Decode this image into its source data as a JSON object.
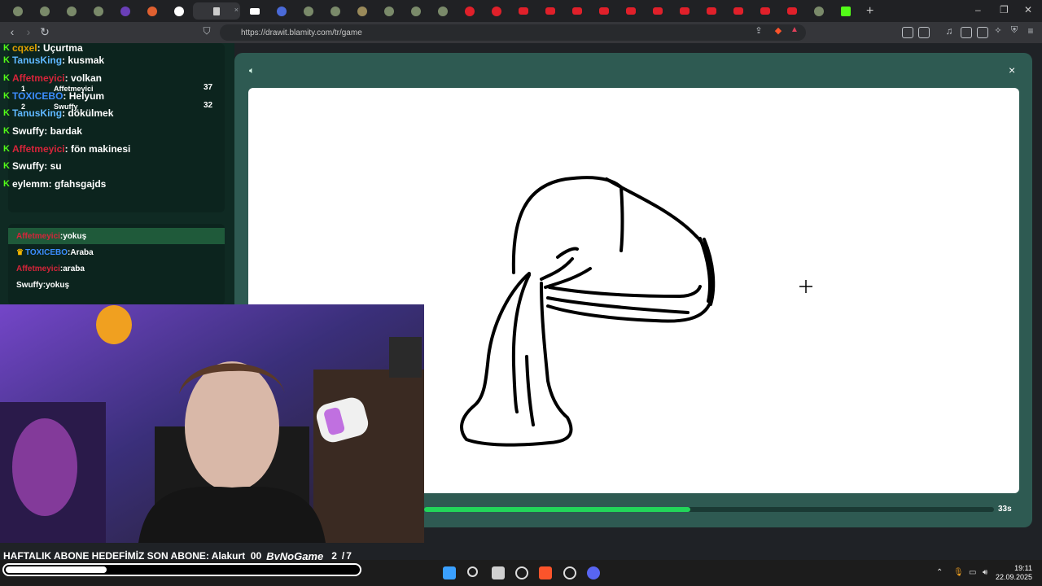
{
  "browser": {
    "url": "https://drawit.blamity.com/tr/game",
    "newtab_label": "+",
    "tab_close_glyph": "×"
  },
  "window_controls": {
    "minimize": "–",
    "maximize": "❐",
    "close": "✕"
  },
  "chat": {
    "messages": [
      {
        "user": "cqxel",
        "user_color": "#e0a000",
        "text": " : Uçurtma"
      },
      {
        "user": "TanusKing",
        "user_color": "#5fb8ff",
        "text": " : kusmak"
      },
      {
        "user": "Affetmeyici",
        "user_color": "#d6253a",
        "text": " : volkan"
      },
      {
        "user": "TOXICEBO",
        "user_color": "#3c8dff",
        "text": " : Helyum"
      },
      {
        "user": "TanusKing",
        "user_color": "#5fb8ff",
        "text": " : dökülmek"
      },
      {
        "user": "Swuffy",
        "user_color": "#ffffff",
        "text": " : bardak"
      },
      {
        "user": "Affetmeyici",
        "user_color": "#d6253a",
        "text": " : fön makinesi"
      },
      {
        "user": "Swuffy",
        "user_color": "#ffffff",
        "text": " : su"
      },
      {
        "user": "eylemm",
        "user_color": "#ffffff",
        "text": " : gfahsgajds"
      }
    ],
    "scoreboard": [
      {
        "rank": "1",
        "name": "Affetmeyici",
        "score": "37"
      },
      {
        "rank": "2",
        "name": "Swuffy",
        "score": "32"
      }
    ]
  },
  "guesses": [
    {
      "user": "Affetmeyici",
      "user_color": "#d6253a",
      "text": ":yokuş"
    },
    {
      "user": "TOXICEBO",
      "user_color": "#3c8dff",
      "text": ":Araba"
    },
    {
      "user": "Affetmeyici",
      "user_color": "#d6253a",
      "text": ":araba"
    },
    {
      "user": "Swuffy",
      "user_color": "#ffffff",
      "text": ":yokuş"
    }
  ],
  "game": {
    "timer_text": "33s",
    "timer_progress": 0.467,
    "sound_icon": "speaker-icon",
    "close_glyph": "×"
  },
  "overlay": {
    "ticker_text": "HAFTALIK ABONE HEDEFİMİZ SON ABONE: Alakurt_00",
    "brand": "ByNoGame",
    "goal_current": "2",
    "goal_sep": "/",
    "goal_total": "7",
    "goal_progress": 0.286
  },
  "taskbar": {
    "time": "19:11",
    "date": "22.09.2025"
  },
  "colors": {
    "accent_green": "#22d65a",
    "kick_green": "#53fc18",
    "game_bg": "#2e5a52"
  }
}
